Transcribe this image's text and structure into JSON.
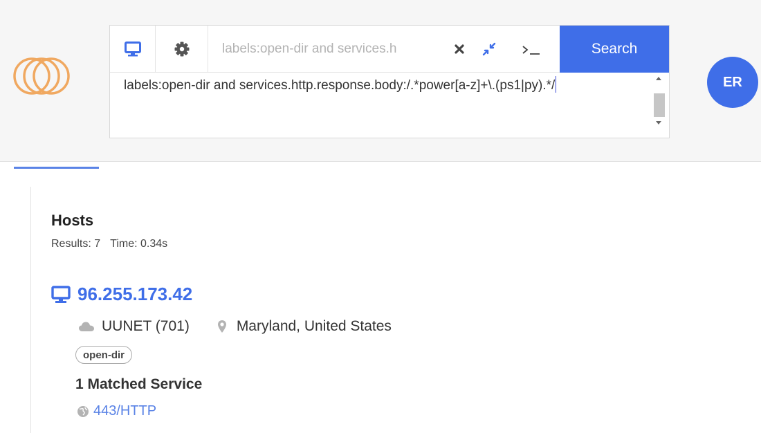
{
  "colors": {
    "accent": "#3f6ee8",
    "link": "#5a83e6",
    "logo": "#f0a860"
  },
  "search": {
    "query_preview": "labels:open-dir and services.h",
    "query_text": "labels:open-dir and services.http.response.body:/.*power[a-z]+\\.(ps1|py).*/",
    "search_label": "Search",
    "icons": [
      "monitor-icon",
      "gear-icon",
      "close-icon",
      "collapse-icon",
      "terminal-icon"
    ]
  },
  "user": {
    "initials": "ER"
  },
  "results": {
    "title": "Hosts",
    "results_label": "Results: 7",
    "time_label": "Time: 0.34s",
    "hosts": [
      {
        "ip": "96.255.173.42",
        "asn": "UUNET (701)",
        "location": "Maryland, United States",
        "label": "open-dir",
        "matched_services": "1 Matched Service",
        "service": "443/HTTP"
      }
    ]
  }
}
